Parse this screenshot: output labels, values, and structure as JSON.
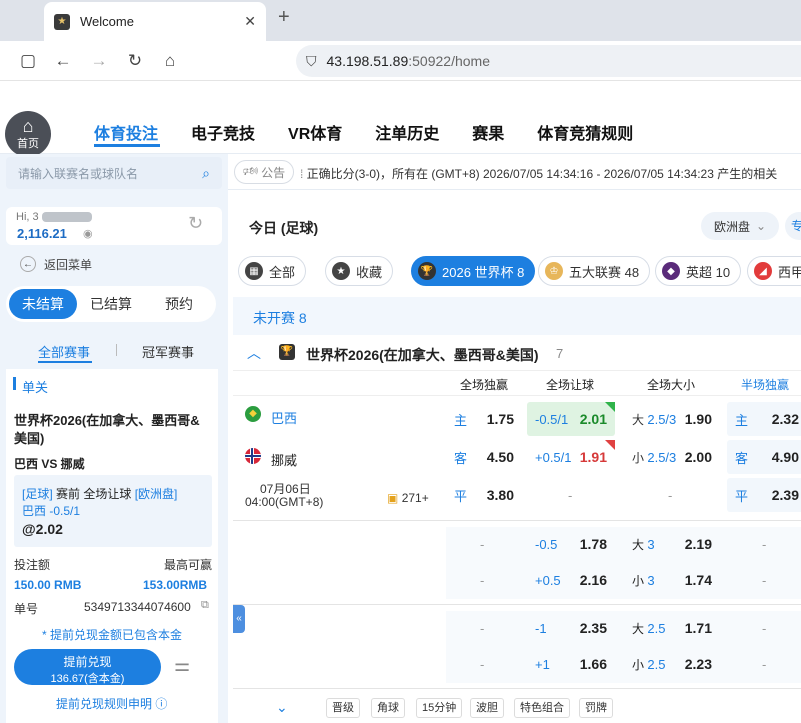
{
  "browser": {
    "tab_title": "Welcome",
    "url_host": "43.198.51.89",
    "url_path": ":50922/home"
  },
  "site": {
    "home_label": "首页",
    "nav": [
      "体育投注",
      "电子竞技",
      "VR体育",
      "注单历史",
      "赛果",
      "体育竞猜规则"
    ],
    "announcement_label": "公告",
    "announcement_text": "正确比分(3-0)，所有在 (GMT+8) 2026/07/05 14:34:16 - 2026/07/05 14:34:23 产生的相关"
  },
  "left": {
    "search_placeholder": "请输入联赛名或球队名",
    "greeting": "Hi, 3",
    "balance": "2,116.21",
    "back_menu": "返回菜单",
    "pills": [
      "未结算",
      "已结算",
      "预约"
    ],
    "subtabs": [
      "全部赛事",
      "冠军赛事"
    ],
    "section": "单关",
    "bet": {
      "league": "世界杯2026(在加拿大、墨西哥&美国)",
      "match": "巴西 VS 挪威",
      "detail_line1_a": "[足球]",
      "detail_line1_b": "赛前 全场让球",
      "detail_line1_c": "[欧洲盘]",
      "detail_line2": "巴西 -0.5/1",
      "odds": "@2.02",
      "stake_label": "投注额",
      "max_win_label": "最高可赢",
      "stake": "150.00 RMB",
      "max_win": "153.00RMB",
      "ticket_label": "单号",
      "ticket_no": "5349713344074600",
      "notice": "* 提前兑现金额已包含本金",
      "cashout_label": "提前兑现",
      "cashout_amount": "136.67(含本金)",
      "rules_link": "提前兑现规则申明"
    }
  },
  "main": {
    "title": "今日 (足球)",
    "odds_format": "欧洲盘",
    "chips": [
      {
        "label": "全部",
        "icon": "grid-icon"
      },
      {
        "label": "收藏",
        "icon": "star-icon"
      },
      {
        "label": "2026 世界杯 8",
        "icon": "trophy-icon"
      },
      {
        "label": "五大联赛 48",
        "icon": "crown-icon"
      },
      {
        "label": "英超 10",
        "icon": "premier-league-icon"
      },
      {
        "label": "西甲",
        "icon": "laliga-icon"
      }
    ],
    "upcoming_label": "未开赛 8",
    "league_title": "世界杯2026(在加拿大、墨西哥&美国)",
    "league_count": "7",
    "col_headers": [
      "全场独赢",
      "全场让球",
      "全场大小",
      "半场独赢"
    ],
    "match": {
      "home": "巴西",
      "away": "挪威",
      "date": "07月06日",
      "time": "04:00(GMT+8)",
      "more_markets": "271+",
      "moneyline": {
        "home_label": "主",
        "home": "1.75",
        "away_label": "客",
        "away": "4.50",
        "draw_label": "平",
        "draw": "3.80"
      },
      "handicap": {
        "home_line": "-0.5/1",
        "home": "2.01",
        "away_line": "+0.5/1",
        "away": "1.91"
      },
      "totals": {
        "over_label": "大",
        "over_line": "2.5/3",
        "over": "1.90",
        "under_label": "小",
        "under_line": "2.5/3",
        "under": "2.00"
      },
      "half_ml": {
        "home_label": "主",
        "home": "2.32",
        "away_label": "客",
        "away": "4.90",
        "draw_label": "平",
        "draw": "2.39"
      }
    },
    "extra_rows": [
      {
        "hcp_line": "-0.5",
        "hcp": "1.78",
        "tot_label": "大",
        "tot_line": "3",
        "tot": "2.19"
      },
      {
        "hcp_line": "+0.5",
        "hcp": "2.16",
        "tot_label": "小",
        "tot_line": "3",
        "tot": "1.74"
      },
      {
        "hcp_line": "-1",
        "hcp": "2.35",
        "tot_label": "大",
        "tot_line": "2.5",
        "tot": "1.71"
      },
      {
        "hcp_line": "+1",
        "hcp": "1.66",
        "tot_label": "小",
        "tot_line": "2.5",
        "tot": "2.23"
      }
    ],
    "dash": "-",
    "footer_chips": [
      "晋级",
      "角球",
      "15分钟",
      "波胆",
      "特色组合",
      "罚牌"
    ]
  }
}
